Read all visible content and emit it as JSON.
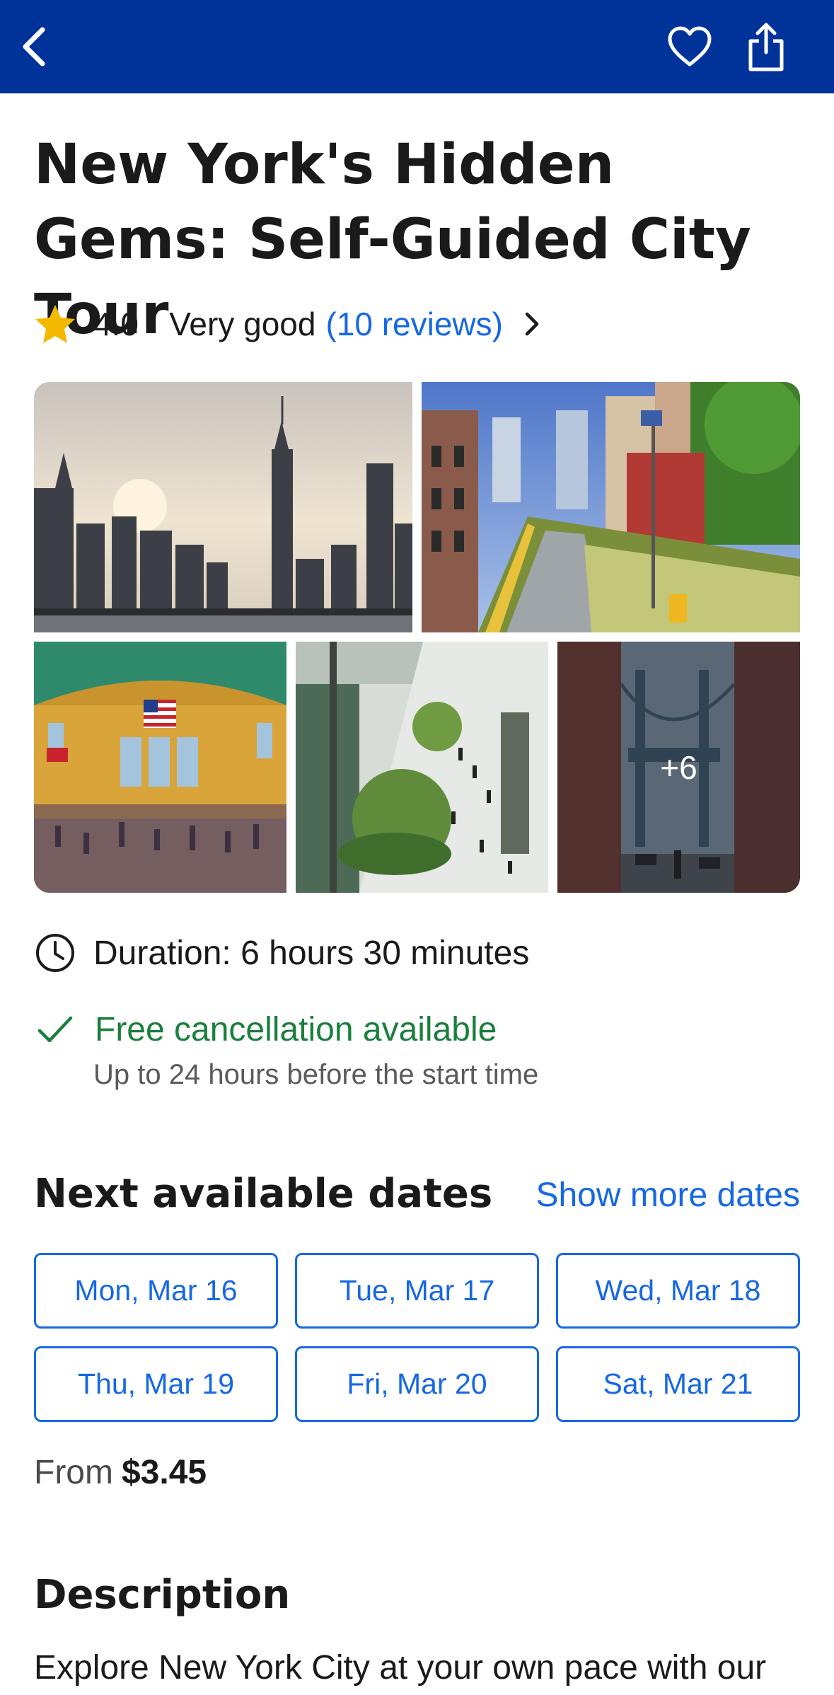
{
  "header": {
    "back_icon": "chevron-left-icon",
    "favorite_icon": "heart-icon",
    "share_icon": "share-icon",
    "background_color": "#003399"
  },
  "activity": {
    "title": "New York's Hidden Gems: Self-Guided City Tour",
    "rating_value": "4.0",
    "rating_separator": "·",
    "rating_label": "Very good",
    "reviews_link": "(10 reviews)",
    "star_color": "#f5b800"
  },
  "gallery": {
    "photos": [
      {
        "name": "manhattan-skyline-photo"
      },
      {
        "name": "high-line-photo"
      },
      {
        "name": "grand-central-photo"
      },
      {
        "name": "garden-plaza-photo"
      },
      {
        "name": "manhattan-bridge-photo"
      }
    ],
    "more_count": "+6"
  },
  "details": {
    "duration": "Duration: 6 hours 30 minutes",
    "cancellation": "Free cancellation available",
    "cancellation_note": "Up to 24 hours before the start time",
    "cancellation_color": "#1a7f3c"
  },
  "dates": {
    "heading": "Next available dates",
    "show_more": "Show more dates",
    "options": [
      "Mon, Mar 16",
      "Tue, Mar 17",
      "Wed, Mar 18",
      "Thu, Mar 19",
      "Fri, Mar 20",
      "Sat, Mar 21"
    ],
    "accent_color": "#1668e3"
  },
  "price": {
    "prefix": "From",
    "amount": "$3.45"
  },
  "description": {
    "heading": "Description",
    "text": "Explore New York City at your own pace with our"
  }
}
